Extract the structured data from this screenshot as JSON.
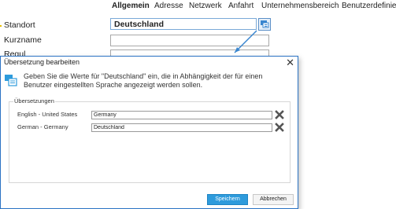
{
  "tabs": [
    {
      "label": "Allgemein",
      "active": true
    },
    {
      "label": "Adresse"
    },
    {
      "label": "Netzwerk"
    },
    {
      "label": "Anfahrt"
    },
    {
      "label": "Unternehmensbereich"
    },
    {
      "label": "Benutzerdefiniert"
    }
  ],
  "form": {
    "standort_label": "Standort",
    "standort_value": "Deutschland",
    "kurzname_label": "Kurzname",
    "third_label_partial": "Regul"
  },
  "dialog": {
    "title": "Übersetzung bearbeiten",
    "close_glyph": "✕",
    "info_text": "Geben Sie die Werte für \"Deutschland\" ein, die in Abhängigkeit der für einen Benutzer eingestellten Sprache angezeigt werden sollen.",
    "group_label": "Übersetzungen",
    "rows": [
      {
        "language": "English - United States",
        "value": "Germany"
      },
      {
        "language": "German - Germany",
        "value": "Deutschland"
      }
    ],
    "save_label": "Speichern",
    "cancel_label": "Abbrechen"
  },
  "icons": {
    "translate": "translate-icon",
    "info": "translation-info-icon",
    "delete": "delete-x-icon",
    "close": "close-icon"
  },
  "colors": {
    "accent": "#2e9bdc",
    "dialog_border": "#2b73c4",
    "marker": "#e8c000",
    "delete_icon": "#555555"
  }
}
